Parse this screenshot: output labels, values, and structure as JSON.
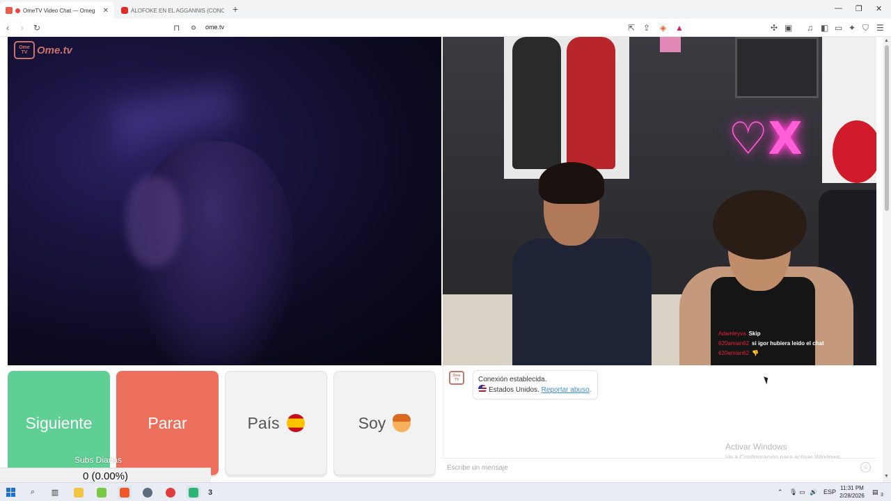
{
  "browser": {
    "tabs": [
      {
        "title": "OmeTV Video Chat — Omeg",
        "active": true,
        "recording": true
      },
      {
        "title": "ALOFOKE EN EL AGGANNIS (CONCIE",
        "active": false
      }
    ],
    "url": "ome.tv"
  },
  "site": {
    "logo_box": "Ome TV",
    "logo_text": "Ome.tv"
  },
  "stream_chat": [
    {
      "user": "Adamleyva",
      "message": "Skip"
    },
    {
      "user": "620amian62",
      "message": "si igor hubiera leido el chat"
    },
    {
      "user": "620amian62",
      "message": "👎"
    }
  ],
  "buttons": {
    "next": "Siguiente",
    "stop": "Parar",
    "country": "País",
    "country_flag": "spain-flag-icon",
    "gender": "Soy",
    "gender_icon": "boy-face-icon"
  },
  "chat": {
    "status": "Conexión establecida.",
    "country": "Estados Unidos.",
    "report": "Reportar abuso",
    "report_suffix": ".",
    "placeholder": "Escribe un mensaje"
  },
  "overlay": {
    "subs_label": "Subs Diarias",
    "subs_value": "0 (0.00%)"
  },
  "windows_watermark": {
    "title": "Activar Windows",
    "subtitle": "Ve a Configuración para activar Windows."
  },
  "taskbar": {
    "badge_count": "3",
    "language": "ESP",
    "time": "11:31 PM",
    "date": "2/28/2026",
    "notification_count": "3"
  },
  "colors": {
    "next": "#5fcf93",
    "stop": "#ec705b",
    "brand": "#c9736a",
    "link": "#3a8fd8"
  }
}
